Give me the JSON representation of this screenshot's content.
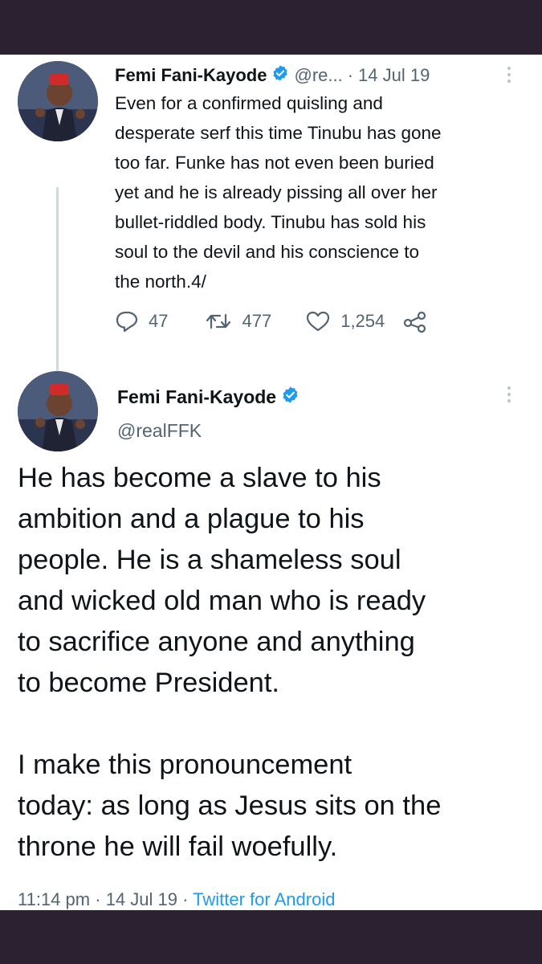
{
  "tweet1": {
    "name": "Femi Fani-Kayode",
    "handle": "@re...",
    "separator": "·",
    "date": "14 Jul 19",
    "text": "Even for a confirmed quisling and\ndesperate serf this time Tinubu has gone\ntoo far. Funke has not even been buried\nyet and he is already pissing all over her\nbullet-riddled body. Tinubu has sold his\nsoul to the devil and his conscience to\nthe north.4/",
    "replies": "47",
    "retweets": "477",
    "likes": "1,254"
  },
  "tweet2": {
    "name": "Femi Fani-Kayode",
    "handle": "@realFFK",
    "text": "He has become a slave to his\nambition and a plague to his\npeople. He is a shameless soul\nand wicked old man who is ready\nto sacrifice anyone and anything\nto become President.\n\nI make this pronouncement\ntoday: as long as Jesus sits on the\nthrone he will fail woefully.",
    "time": "11:14 pm",
    "date": "14 Jul 19",
    "dot": "·",
    "source": "Twitter for Android"
  },
  "colors": {
    "verified": "#1d9bf0",
    "text": "#0f1419",
    "muted": "#536471",
    "frame": "#2b2130"
  },
  "icons": [
    "verified-badge-icon",
    "more-icon",
    "reply-icon",
    "retweet-icon",
    "like-icon",
    "share-icon"
  ]
}
